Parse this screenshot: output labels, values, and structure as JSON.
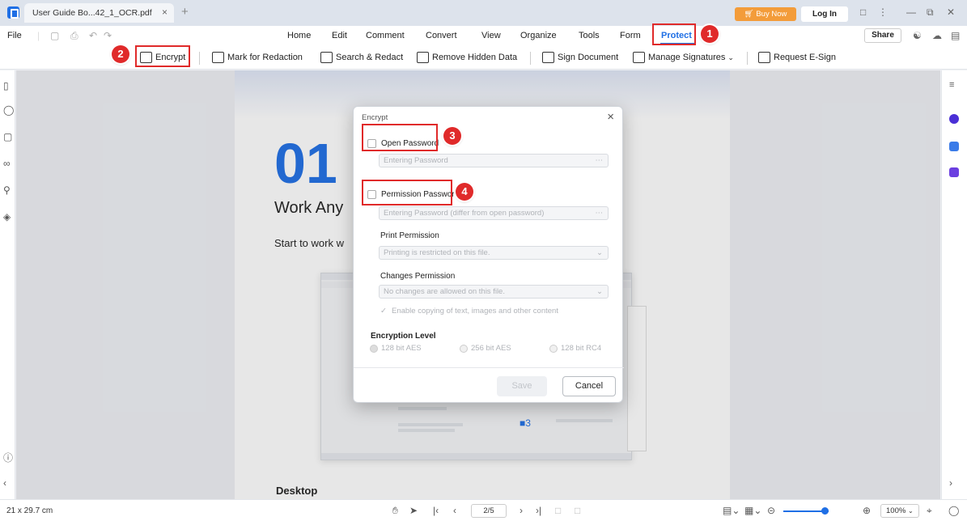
{
  "titlebar": {
    "tab_title": "User Guide Bo...42_1_OCR.pdf",
    "buy_now": "Buy Now",
    "login": "Log In"
  },
  "menubar": {
    "file": "File",
    "items": [
      "Home",
      "Edit",
      "Comment",
      "Convert",
      "View",
      "Organize",
      "Tools",
      "Form",
      "Protect"
    ],
    "share": "Share"
  },
  "ribbon": {
    "encrypt": "Encrypt",
    "mark_for_redaction": "Mark for Redaction",
    "search_redact": "Search & Redact",
    "remove_hidden_data": "Remove Hidden Data",
    "sign_document": "Sign Document",
    "manage_signatures": "Manage Signatures",
    "request_esign": "Request E-Sign"
  },
  "document": {
    "chapter_number": "01",
    "chapter_title": "Work Any",
    "intro": "Start to work w",
    "section": "Desktop",
    "embedded_number": "3"
  },
  "dialog": {
    "title": "Encrypt",
    "open_password_label": "Open Password",
    "open_password_placeholder": "Entering Password",
    "permission_password_label": "Permission Password",
    "permission_password_placeholder": "Entering Password (differ from open password)",
    "print_permission_label": "Print Permission",
    "print_permission_value": "Printing is restricted on this file.",
    "changes_permission_label": "Changes Permission",
    "changes_permission_value": "No changes are allowed on this file.",
    "copy_option": "Enable copying of text, images and other content",
    "encryption_level_label": "Encryption Level",
    "levels": [
      "128 bit AES",
      "256 bit AES",
      "128 bit RC4"
    ],
    "save": "Save",
    "cancel": "Cancel"
  },
  "callouts": [
    "1",
    "2",
    "3",
    "4"
  ],
  "statusbar": {
    "page_size": "21 x 29.7 cm",
    "page_indicator": "2/5",
    "zoom": "100%"
  },
  "colors": {
    "accent": "#1f6fe5",
    "callout_red": "#e02a2a",
    "buy_now": "#f39c3a"
  }
}
